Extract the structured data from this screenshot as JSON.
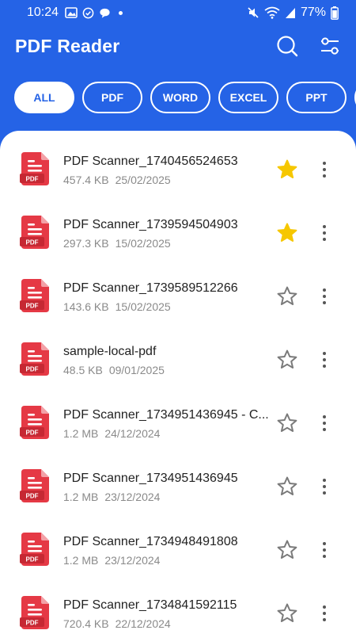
{
  "status": {
    "time": "10:24",
    "battery": "77%"
  },
  "app": {
    "title": "PDF Reader"
  },
  "filters": [
    {
      "label": "ALL",
      "active": true
    },
    {
      "label": "PDF",
      "active": false
    },
    {
      "label": "WORD",
      "active": false
    },
    {
      "label": "EXCEL",
      "active": false
    },
    {
      "label": "PPT",
      "active": false
    }
  ],
  "files": [
    {
      "name": "PDF Scanner_1740456524653",
      "size": "457.4 KB",
      "date": "25/02/2025",
      "starred": true
    },
    {
      "name": "PDF Scanner_1739594504903",
      "size": "297.3 KB",
      "date": "15/02/2025",
      "starred": true
    },
    {
      "name": "PDF Scanner_1739589512266",
      "size": "143.6 KB",
      "date": "15/02/2025",
      "starred": false
    },
    {
      "name": "sample-local-pdf",
      "size": "48.5 KB",
      "date": "09/01/2025",
      "starred": false
    },
    {
      "name": "PDF Scanner_1734951436945 - C...",
      "size": "1.2 MB",
      "date": "24/12/2024",
      "starred": false
    },
    {
      "name": "PDF Scanner_1734951436945",
      "size": "1.2 MB",
      "date": "23/12/2024",
      "starred": false
    },
    {
      "name": "PDF Scanner_1734948491808",
      "size": "1.2 MB",
      "date": "23/12/2024",
      "starred": false
    },
    {
      "name": "PDF Scanner_1734841592115",
      "size": "720.4 KB",
      "date": "22/12/2024",
      "starred": false
    }
  ],
  "icons": {
    "search": "search-icon",
    "filter": "sliders-icon",
    "file": "pdf-file-icon",
    "favorite": "star-icon",
    "more": "more-vert-icon"
  },
  "colors": {
    "primary": "#2563e6",
    "pdf_red": "#e53945",
    "star_gold": "#f6c700"
  }
}
